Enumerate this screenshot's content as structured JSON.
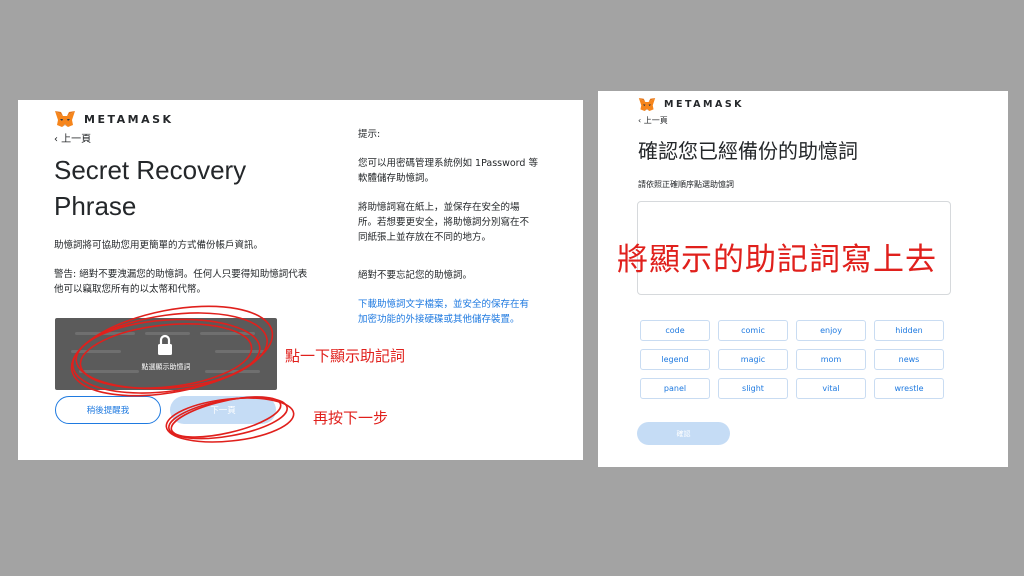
{
  "left": {
    "brand": "METAMASK",
    "back": "‹ 上一頁",
    "title": "Secret Recovery Phrase",
    "para1": "助憶詞將可協助您用更簡單的方式備份帳戶資訊。",
    "para2": "警告: 絕對不要洩漏您的助憶詞。任何人只要得知助憶詞代表他可以竊取您所有的以太幣和代幣。",
    "hint_title": "提示:",
    "hint1": "您可以用密碼管理系統例如 1Password 等軟體儲存助憶詞。",
    "hint2": "將助憶詞寫在紙上，並保存在安全的場所。若想要更安全，將助憶詞分別寫在不同紙張上並存放在不同的地方。",
    "hint3": "絕對不要忘記您的助憶詞。",
    "hint_link": "下載助憶詞文字檔案，並安全的保存在有加密功能的外接硬碟或其他儲存裝置。",
    "reveal_label": "點選顯示助憶詞",
    "remind_later": "稍後提醒我",
    "next": "下一頁",
    "annotation_click": "點一下顯示助記詞",
    "annotation_next": "再按下一步"
  },
  "right": {
    "brand": "METAMASK",
    "back": "‹ 上一頁",
    "title": "確認您已經備份的助憶詞",
    "subtitle": "請依照正確順序點選助憶詞",
    "annotation_fill": "將顯示的助記詞寫上去",
    "words": [
      "code",
      "comic",
      "enjoy",
      "hidden",
      "legend",
      "magic",
      "mom",
      "news",
      "panel",
      "slight",
      "vital",
      "wrestle"
    ],
    "confirm": "確認"
  },
  "colors": {
    "accent": "#1f7ae0",
    "annotation": "#e0201c",
    "disabled": "#c5dcf5",
    "reveal_box": "#5b5b5b"
  }
}
